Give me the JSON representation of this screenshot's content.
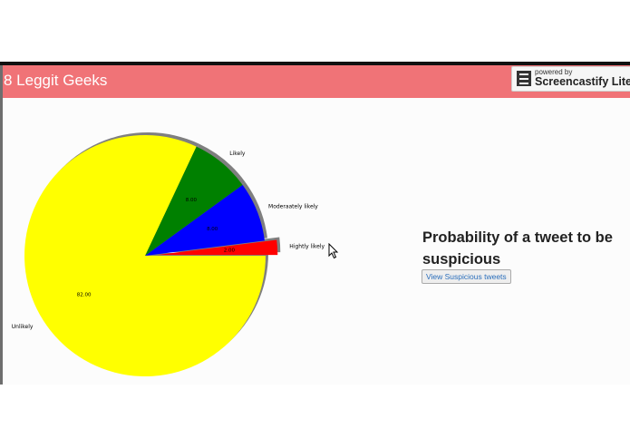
{
  "header": {
    "title": "8 Leggit Geeks"
  },
  "watermark": {
    "powered_by": "powered by",
    "brand": "Screencastify Lite"
  },
  "main": {
    "heading": "Probability of a tweet to be suspicious",
    "button_label": "View Suspicious tweets"
  },
  "colors": {
    "header_bg": "#f07377",
    "unlikely": "#ffff00",
    "likely": "#008000",
    "moderately": "#0000ff",
    "highly": "#ff0000"
  },
  "chart_data": {
    "type": "pie",
    "labels": [
      "Hightly likely",
      "Moderaately likely",
      "Likely",
      "Unlikely"
    ],
    "values": [
      2.0,
      8.0,
      8.0,
      82.0
    ],
    "value_labels": [
      "2.00",
      "8.00",
      "8.00",
      "82.00"
    ],
    "colors": [
      "#ff0000",
      "#0000ff",
      "#008000",
      "#ffff00"
    ],
    "explode": [
      0.1,
      0,
      0,
      0
    ],
    "shadow": true,
    "start_angle_deg": 0
  }
}
